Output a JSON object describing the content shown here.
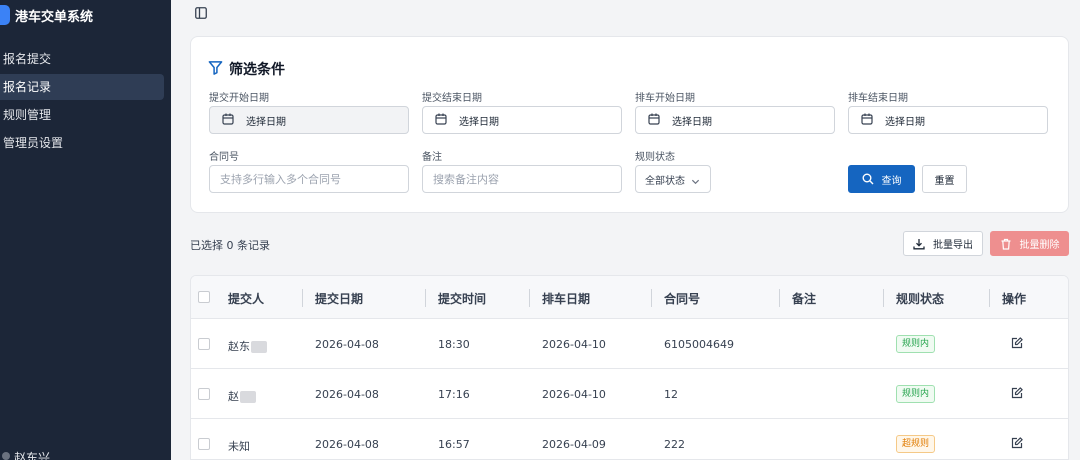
{
  "app": {
    "title": "港车交单系统"
  },
  "sidebar": {
    "items": [
      {
        "label": "报名提交",
        "active": false
      },
      {
        "label": "报名记录",
        "active": true
      },
      {
        "label": "规则管理",
        "active": false
      },
      {
        "label": "管理员设置",
        "active": false
      }
    ],
    "user_name": "赵东兴"
  },
  "filters": {
    "title": "筛选条件",
    "submit_start": {
      "label": "提交开始日期",
      "value": "选择日期"
    },
    "submit_end": {
      "label": "提交结束日期",
      "value": "选择日期"
    },
    "schedule_start": {
      "label": "排车开始日期",
      "value": "选择日期"
    },
    "schedule_end": {
      "label": "排车结束日期",
      "value": "选择日期"
    },
    "contract": {
      "label": "合同号",
      "placeholder": "支持多行输入多个合同号"
    },
    "remark": {
      "label": "备注",
      "placeholder": "搜索备注内容"
    },
    "rule_status": {
      "label": "规则状态",
      "value": "全部状态"
    },
    "query_label": "查询",
    "reset_label": "重置"
  },
  "toolbar": {
    "selected_text": "已选择 0 条记录",
    "export_label": "批量导出",
    "delete_label": "批量删除"
  },
  "table": {
    "columns": [
      "提交人",
      "提交日期",
      "提交时间",
      "排车日期",
      "合同号",
      "备注",
      "规则状态",
      "操作"
    ],
    "rows": [
      {
        "submitter": "赵东",
        "submit_date": "2026-04-08",
        "submit_time": "18:30",
        "schedule_date": "2026-04-10",
        "contract": "6105004649",
        "remark": "",
        "status": "规则内"
      },
      {
        "submitter": "赵",
        "submit_date": "2026-04-08",
        "submit_time": "17:16",
        "schedule_date": "2026-04-10",
        "contract": "12",
        "remark": "",
        "status": "规则内"
      },
      {
        "submitter": "未知",
        "submit_date": "2026-04-08",
        "submit_time": "16:57",
        "schedule_date": "2026-04-09",
        "contract": "222",
        "remark": "",
        "status": "超规则"
      }
    ]
  },
  "colors": {
    "sidebar_bg": "#1c2638",
    "primary": "#1565c0",
    "danger": "#ee8f8f",
    "tag_ok": "#22a34a",
    "tag_over": "#e07b00"
  },
  "icons": {
    "sidebar_toggle": "sidebar-toggle-icon",
    "filter": "filter-icon",
    "calendar": "calendar-icon",
    "chevron": "chevron-down-icon",
    "search": "search-icon",
    "download": "download-icon",
    "trash": "trash-icon",
    "edit": "edit-icon"
  }
}
